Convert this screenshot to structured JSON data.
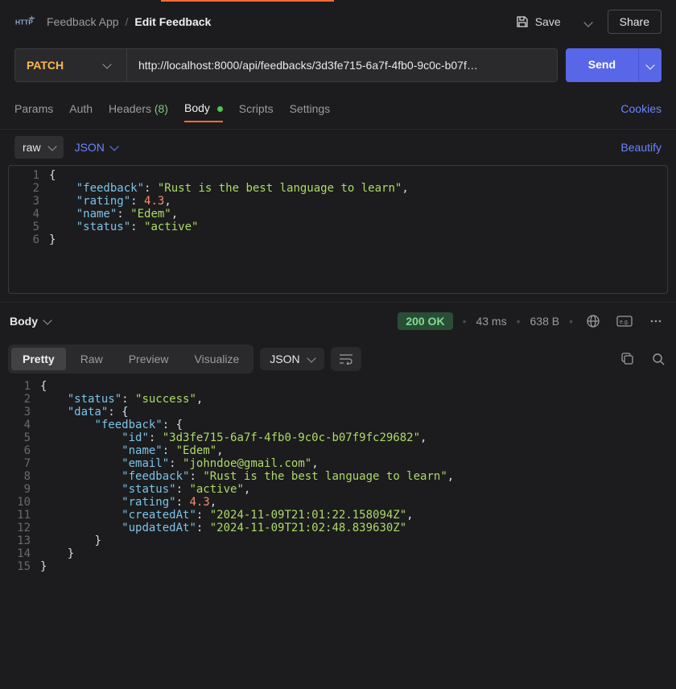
{
  "breadcrumb": {
    "collection": "Feedback App",
    "request": "Edit Feedback"
  },
  "header": {
    "save": "Save",
    "share": "Share"
  },
  "request": {
    "method": "PATCH",
    "url": "http://localhost:8000/api/feedbacks/3d3fe715-6a7f-4fb0-9c0c-b07f…",
    "send": "Send"
  },
  "tabs": {
    "params": "Params",
    "auth": "Auth",
    "headers": "Headers",
    "headers_count": "(8)",
    "body": "Body",
    "scripts": "Scripts",
    "settings": "Settings",
    "cookies": "Cookies"
  },
  "body_toolbar": {
    "raw": "raw",
    "json": "JSON",
    "beautify": "Beautify"
  },
  "request_body_lines": [
    [
      {
        "t": "brace",
        "v": "{"
      }
    ],
    [
      {
        "t": "indent",
        "v": "    "
      },
      {
        "t": "key",
        "v": "\"feedback\""
      },
      {
        "t": "punc",
        "v": ": "
      },
      {
        "t": "str",
        "v": "\"Rust is the best language to learn\""
      },
      {
        "t": "punc",
        "v": ","
      }
    ],
    [
      {
        "t": "indent",
        "v": "    "
      },
      {
        "t": "key",
        "v": "\"rating\""
      },
      {
        "t": "punc",
        "v": ": "
      },
      {
        "t": "num",
        "v": "4.3"
      },
      {
        "t": "punc",
        "v": ","
      }
    ],
    [
      {
        "t": "indent",
        "v": "    "
      },
      {
        "t": "key",
        "v": "\"name\""
      },
      {
        "t": "punc",
        "v": ": "
      },
      {
        "t": "str",
        "v": "\"Edem\""
      },
      {
        "t": "punc",
        "v": ","
      }
    ],
    [
      {
        "t": "indent",
        "v": "    "
      },
      {
        "t": "key",
        "v": "\"status\""
      },
      {
        "t": "punc",
        "v": ": "
      },
      {
        "t": "str",
        "v": "\"active\""
      }
    ],
    [
      {
        "t": "brace",
        "v": "}"
      }
    ]
  ],
  "response": {
    "body_label": "Body",
    "status": "200 OK",
    "time": "43 ms",
    "size": "638 B",
    "views": {
      "pretty": "Pretty",
      "raw": "Raw",
      "preview": "Preview",
      "visualize": "Visualize"
    },
    "format": "JSON"
  },
  "response_body_lines": [
    [
      {
        "t": "brace",
        "v": "{"
      }
    ],
    [
      {
        "t": "indent",
        "v": "    "
      },
      {
        "t": "key",
        "v": "\"status\""
      },
      {
        "t": "punc",
        "v": ": "
      },
      {
        "t": "str",
        "v": "\"success\""
      },
      {
        "t": "punc",
        "v": ","
      }
    ],
    [
      {
        "t": "indent",
        "v": "    "
      },
      {
        "t": "key",
        "v": "\"data\""
      },
      {
        "t": "punc",
        "v": ": "
      },
      {
        "t": "brace",
        "v": "{"
      }
    ],
    [
      {
        "t": "indent",
        "v": "        "
      },
      {
        "t": "key",
        "v": "\"feedback\""
      },
      {
        "t": "punc",
        "v": ": "
      },
      {
        "t": "brace",
        "v": "{"
      }
    ],
    [
      {
        "t": "indent",
        "v": "            "
      },
      {
        "t": "key",
        "v": "\"id\""
      },
      {
        "t": "punc",
        "v": ": "
      },
      {
        "t": "str",
        "v": "\"3d3fe715-6a7f-4fb0-9c0c-b07f9fc29682\""
      },
      {
        "t": "punc",
        "v": ","
      }
    ],
    [
      {
        "t": "indent",
        "v": "            "
      },
      {
        "t": "key",
        "v": "\"name\""
      },
      {
        "t": "punc",
        "v": ": "
      },
      {
        "t": "str",
        "v": "\"Edem\""
      },
      {
        "t": "punc",
        "v": ","
      }
    ],
    [
      {
        "t": "indent",
        "v": "            "
      },
      {
        "t": "key",
        "v": "\"email\""
      },
      {
        "t": "punc",
        "v": ": "
      },
      {
        "t": "str",
        "v": "\"johndoe@gmail.com\""
      },
      {
        "t": "punc",
        "v": ","
      }
    ],
    [
      {
        "t": "indent",
        "v": "            "
      },
      {
        "t": "key",
        "v": "\"feedback\""
      },
      {
        "t": "punc",
        "v": ": "
      },
      {
        "t": "str",
        "v": "\"Rust is the best language to learn\""
      },
      {
        "t": "punc",
        "v": ","
      }
    ],
    [
      {
        "t": "indent",
        "v": "            "
      },
      {
        "t": "key",
        "v": "\"status\""
      },
      {
        "t": "punc",
        "v": ": "
      },
      {
        "t": "str",
        "v": "\"active\""
      },
      {
        "t": "punc",
        "v": ","
      }
    ],
    [
      {
        "t": "indent",
        "v": "            "
      },
      {
        "t": "key",
        "v": "\"rating\""
      },
      {
        "t": "punc",
        "v": ": "
      },
      {
        "t": "num",
        "v": "4.3"
      },
      {
        "t": "punc",
        "v": ","
      }
    ],
    [
      {
        "t": "indent",
        "v": "            "
      },
      {
        "t": "key",
        "v": "\"createdAt\""
      },
      {
        "t": "punc",
        "v": ": "
      },
      {
        "t": "str",
        "v": "\"2024-11-09T21:01:22.158094Z\""
      },
      {
        "t": "punc",
        "v": ","
      }
    ],
    [
      {
        "t": "indent",
        "v": "            "
      },
      {
        "t": "key",
        "v": "\"updatedAt\""
      },
      {
        "t": "punc",
        "v": ": "
      },
      {
        "t": "str",
        "v": "\"2024-11-09T21:02:48.839630Z\""
      }
    ],
    [
      {
        "t": "indent",
        "v": "        "
      },
      {
        "t": "brace",
        "v": "}"
      }
    ],
    [
      {
        "t": "indent",
        "v": "    "
      },
      {
        "t": "brace",
        "v": "}"
      }
    ],
    [
      {
        "t": "brace",
        "v": "}"
      }
    ]
  ]
}
